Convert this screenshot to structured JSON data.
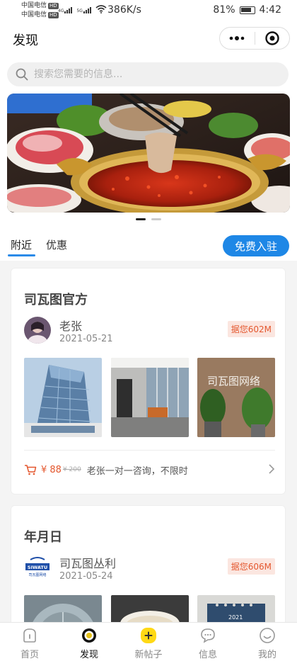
{
  "status_bar": {
    "carrier1": "中国电信",
    "carrier2": "中国电信",
    "hd": "HD",
    "net1": "4G",
    "net2": "5G",
    "speed": "386K/s",
    "battery": "81%",
    "time": "4:42"
  },
  "nav": {
    "title": "发现"
  },
  "search": {
    "placeholder": "搜索您需要的信息..."
  },
  "banner": {
    "slides": 2,
    "active_index": 0
  },
  "tabs": {
    "items": [
      {
        "label": "附近",
        "active": true
      },
      {
        "label": "优惠",
        "active": false
      }
    ],
    "join_label": "免费入驻"
  },
  "posts": [
    {
      "title": "司瓦图官方",
      "author": "老张",
      "date": "2021-05-21",
      "distance": "据您602M",
      "photo3_text": "司瓦图网络",
      "deal": {
        "price": "¥ 88",
        "old_price": "¥ 200",
        "text": "老张一对一咨询，不限时"
      }
    },
    {
      "title": "年月日",
      "author": "司瓦图丛利",
      "date": "2021-05-24",
      "distance": "据您606M",
      "logo_text": "SIWATU",
      "logo_sub": "司瓦图网络",
      "photo3_text": "2021"
    }
  ],
  "tabbar": [
    {
      "label": "首页",
      "icon": "home-icon",
      "active": false
    },
    {
      "label": "发现",
      "icon": "discover-icon",
      "active": true
    },
    {
      "label": "新帖子",
      "icon": "plus-icon",
      "active": false
    },
    {
      "label": "信息",
      "icon": "message-icon",
      "active": false
    },
    {
      "label": "我的",
      "icon": "profile-icon",
      "active": false
    }
  ],
  "colors": {
    "accent": "#1e87e6",
    "price": "#e4572e",
    "new_post": "#ffd915"
  }
}
